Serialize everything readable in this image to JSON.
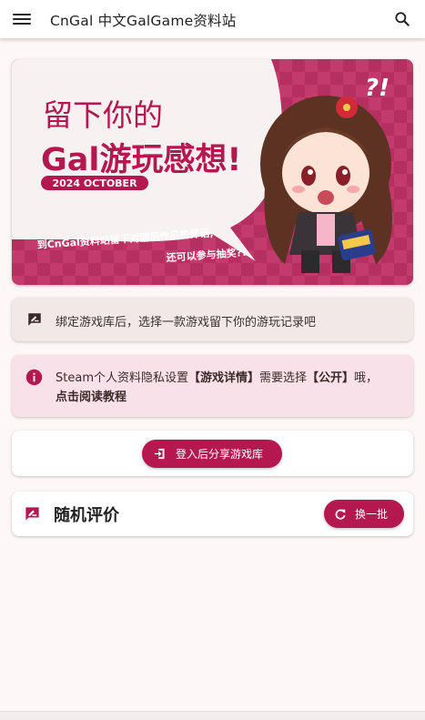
{
  "appbar": {
    "title": "CnGal 中文GalGame资料站",
    "menu_icon": "menu-icon",
    "search_icon": "search-icon"
  },
  "banner": {
    "title_line1": "留下你的",
    "title_line2": "Gal游玩感想!",
    "date_badge": "2024 OCTOBER",
    "caption_line1": "到CnGal资料站留下对游玩作品的评语,",
    "caption_line2": "还可以参与抽奖?!",
    "marks": "?!"
  },
  "bind_card": {
    "icon": "rate-review-icon",
    "text": "绑定游戏库后，选择一款游戏留下你的游玩记录吧"
  },
  "steam_card": {
    "icon": "info-icon",
    "text_a": "Steam个人资料隐私设置",
    "text_b": "【游戏详情】",
    "text_c": "需要选择",
    "text_d": "【公开】",
    "text_e": "哦，",
    "link": "点击阅读教程"
  },
  "login_card": {
    "button_label": "登入后分享游戏库",
    "icon": "login-icon"
  },
  "random_card": {
    "icon": "rate-review-icon",
    "title": "随机评价",
    "button_label": "换一批",
    "button_icon": "refresh-icon"
  },
  "colors": {
    "accent": "#b5174f",
    "banner_bg": "#c0386a",
    "steam_bg": "#f9e1ea",
    "bind_bg": "#f3e8e8"
  }
}
